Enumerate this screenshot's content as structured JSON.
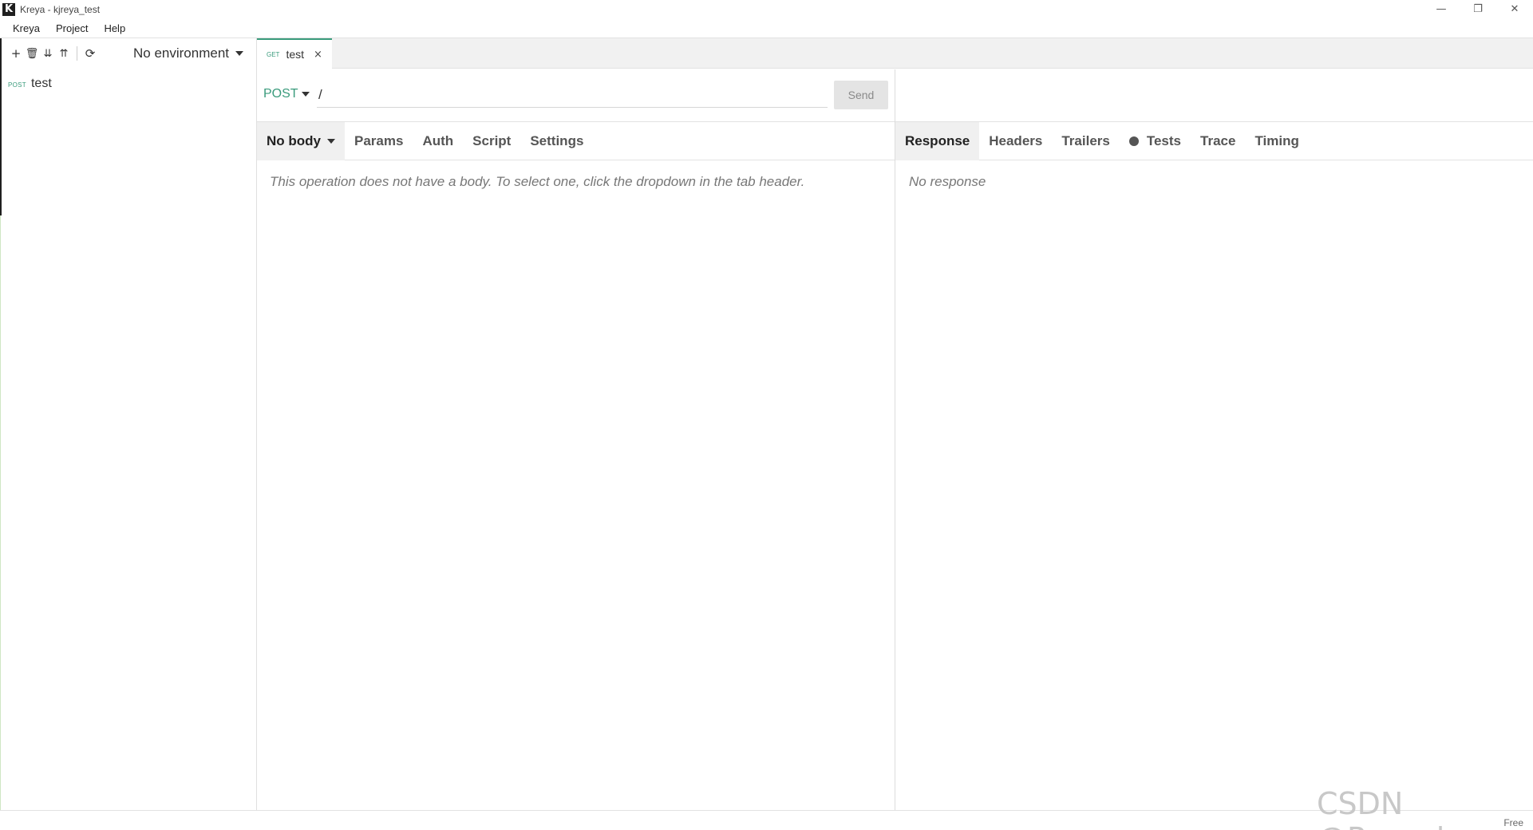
{
  "window": {
    "logo": "K",
    "title": "Kreya - kjreya_test",
    "controls": {
      "minimize": "—",
      "maximize": "❐",
      "close": "✕"
    }
  },
  "menu": [
    "Kreya",
    "Project",
    "Help"
  ],
  "sidebar": {
    "tools": {
      "add": "+",
      "delete": "🗑",
      "expand": "⇊",
      "collapse": "⇈",
      "refresh": "⟳"
    },
    "environment": "No environment",
    "tree": [
      {
        "method": "POST",
        "label": "test"
      }
    ]
  },
  "tabs": [
    {
      "method": "GET",
      "label": "test",
      "close": "×"
    }
  ],
  "request": {
    "method": "POST",
    "url": "/",
    "send_label": "Send",
    "tabs": [
      "No body",
      "Params",
      "Auth",
      "Script",
      "Settings"
    ],
    "active_tab": "No body",
    "body_message": "This operation does not have a body. To select one, click the dropdown in the tab header."
  },
  "response": {
    "tabs": [
      "Response",
      "Headers",
      "Trailers",
      "Tests",
      "Trace",
      "Timing"
    ],
    "active_tab": "Response",
    "message": "No response"
  },
  "status": {
    "license": "Free"
  },
  "watermark": "CSDN @Panesle",
  "colors": {
    "accent": "#3a9b7c"
  }
}
